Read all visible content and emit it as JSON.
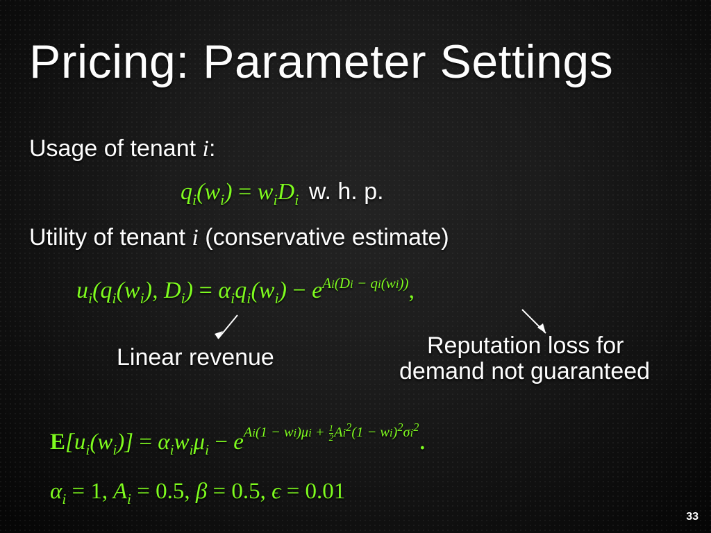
{
  "title": "Pricing: Parameter Settings",
  "lines": {
    "usage_pre": "Usage of tenant ",
    "usage_var": "i",
    "usage_post": ":",
    "whp": " w. h. p.",
    "utility_pre": "Utility of tenant ",
    "utility_var": "i",
    "utility_post": " (conservative estimate)"
  },
  "equations": {
    "usage_eq": "qᵢ(wᵢ) = wᵢDᵢ",
    "utility_eq_lhs": "uᵢ(qᵢ(wᵢ), Dᵢ) = αᵢqᵢ(wᵢ) − e",
    "utility_eq_exp": "Aᵢ(Dᵢ − qᵢ(wᵢ))",
    "utility_eq_tail": ",",
    "expectation_lhs": "𝐄[uᵢ(wᵢ)] = αᵢwᵢμᵢ − e",
    "expectation_exp_a": "Aᵢ(1 − wᵢ)μᵢ + ",
    "expectation_exp_half": "½",
    "expectation_exp_b": "Aᵢ²(1 − wᵢ)²σᵢ²",
    "expectation_tail": ".",
    "params": "αᵢ = 1, Aᵢ = 0.5, β = 0.5, ε = 0.01"
  },
  "annotations": {
    "linear_rev": "Linear revenue",
    "rep_loss_l1": "Reputation loss for",
    "rep_loss_l2": "demand not guaranteed"
  },
  "page_number": "33"
}
